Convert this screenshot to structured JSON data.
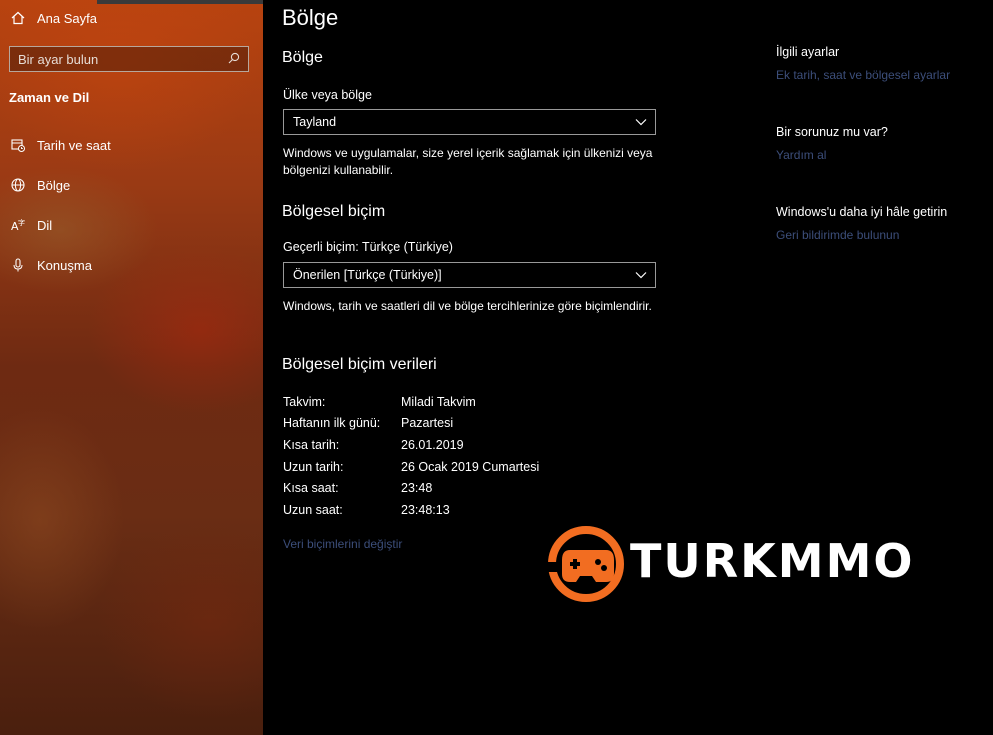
{
  "sidebar": {
    "home_label": "Ana Sayfa",
    "search_placeholder": "Bir ayar bulun",
    "section_title": "Zaman ve Dil",
    "items": [
      {
        "label": "Tarih ve saat",
        "icon": "calendar-clock-icon"
      },
      {
        "label": "Bölge",
        "icon": "globe-icon"
      },
      {
        "label": "Dil",
        "icon": "language-icon"
      },
      {
        "label": "Konuşma",
        "icon": "microphone-icon"
      }
    ]
  },
  "main": {
    "page_title": "Bölge",
    "region": {
      "heading": "Bölge",
      "country_label": "Ülke veya bölge",
      "country_value": "Tayland",
      "description": "Windows ve uygulamalar, size yerel içerik sağlamak için ülkenizi veya bölgenizi kullanabilir."
    },
    "format": {
      "heading": "Bölgesel biçim",
      "current_label": "Geçerli biçim: Türkçe (Türkiye)",
      "format_value": "Önerilen [Türkçe (Türkiye)]",
      "description": "Windows, tarih ve saatleri dil ve bölge tercihlerinize göre biçimlendirir."
    },
    "format_data": {
      "heading": "Bölgesel biçim verileri",
      "rows": [
        {
          "key": "Takvim:",
          "value": "Miladi Takvim"
        },
        {
          "key": "Haftanın ilk günü:",
          "value": "Pazartesi"
        },
        {
          "key": "Kısa tarih:",
          "value": "26.01.2019"
        },
        {
          "key": "Uzun tarih:",
          "value": "26 Ocak 2019 Cumartesi"
        },
        {
          "key": "Kısa saat:",
          "value": "23:48"
        },
        {
          "key": "Uzun saat:",
          "value": "23:48:13"
        }
      ],
      "change_link": "Veri biçimlerini değiştir"
    }
  },
  "right": {
    "related_title": "İlgili ayarlar",
    "related_link": "Ek tarih, saat ve bölgesel ayarlar",
    "question_title": "Bir sorunuz mu var?",
    "help_link": "Yardım al",
    "improve_title": "Windows'u daha iyi hâle getirin",
    "feedback_link": "Geri bildirimde bulunun"
  },
  "watermark": {
    "text": "TURKMMO",
    "accent": "#f26d21"
  },
  "colors": {
    "link": "#3c4e7a",
    "background": "#000000",
    "sidebar_accent": "#b8430f"
  }
}
